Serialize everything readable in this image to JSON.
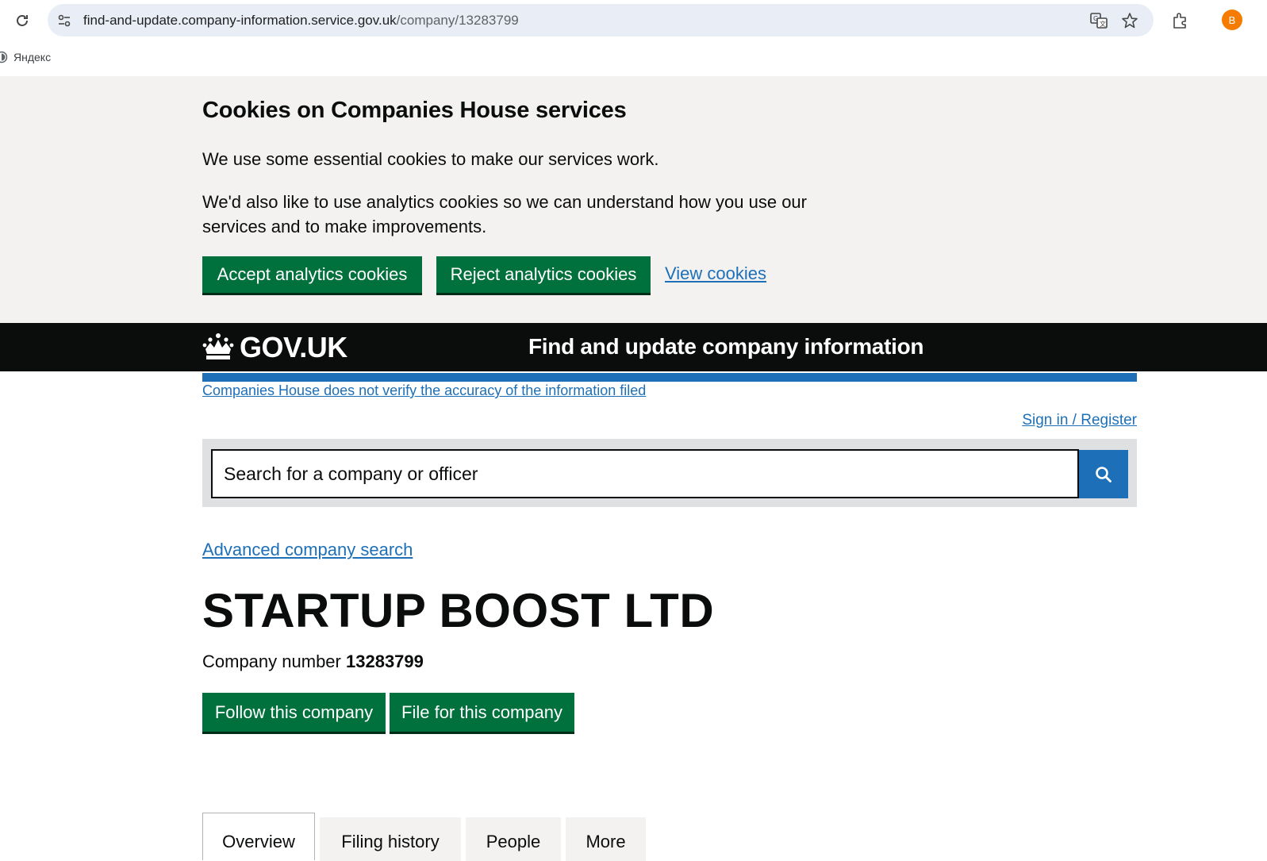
{
  "browser": {
    "url_host": "find-and-update.company-information.service.gov.uk",
    "url_path": "/company/13283799",
    "profile_initial": "B",
    "bookmark_label": "Яндекс"
  },
  "cookie_banner": {
    "title": "Cookies on Companies House services",
    "paragraph_1": "We use some essential cookies to make our services work.",
    "paragraph_2": "We'd also like to use analytics cookies so we can understand how you use our services and to make improvements.",
    "accept_label": "Accept analytics cookies",
    "reject_label": "Reject analytics cookies",
    "view_label": "View cookies"
  },
  "header": {
    "logo_text": "GOV.UK",
    "service_name": "Find and update company information"
  },
  "notice_link": "Companies House does not verify the accuracy of the information filed",
  "sign_in_label": "Sign in / Register",
  "search": {
    "placeholder": "Search for a company or officer"
  },
  "advanced_search_label": "Advanced company search",
  "company": {
    "name": "STARTUP BOOST LTD",
    "number_label": "Company number",
    "number": "13283799",
    "follow_label": "Follow this company",
    "file_label": "File for this company"
  },
  "tabs": [
    {
      "label": "Overview"
    },
    {
      "label": "Filing history"
    },
    {
      "label": "People"
    },
    {
      "label": "More"
    }
  ],
  "colors": {
    "button_green": "#00703c",
    "link_blue": "#1d70b8",
    "header_black": "#0b0c0c",
    "banner_grey": "#f3f2f1"
  }
}
